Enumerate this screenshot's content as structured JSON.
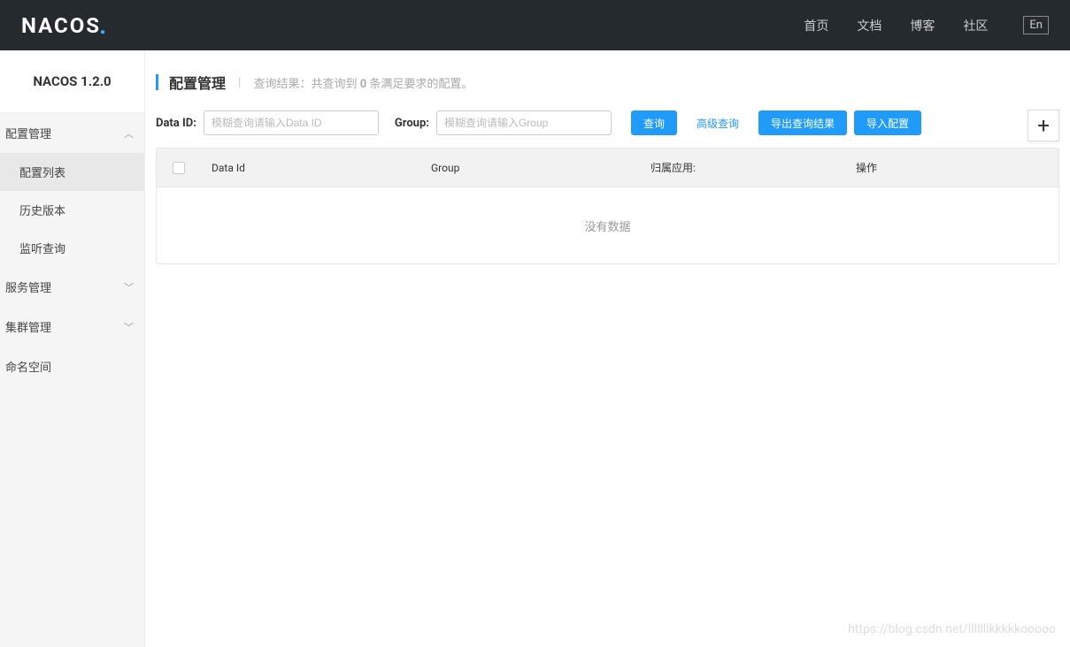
{
  "header": {
    "logo_text": "NACOS",
    "nav": [
      "首页",
      "文档",
      "博客",
      "社区"
    ],
    "lang": "En"
  },
  "sidebar": {
    "version": "NACOS 1.2.0",
    "groups": [
      {
        "label": "配置管理",
        "expanded": true,
        "items": [
          "配置列表",
          "历史版本",
          "监听查询"
        ],
        "active_item": 0
      },
      {
        "label": "服务管理",
        "expanded": false
      },
      {
        "label": "集群管理",
        "expanded": false
      },
      {
        "label": "命名空间",
        "expanded": null
      }
    ]
  },
  "main": {
    "title": "配置管理",
    "summary_prefix": "查询结果：共查询到",
    "summary_count": "0",
    "summary_suffix": "条满足要求的配置。",
    "filters": {
      "dataid_label": "Data ID:",
      "dataid_placeholder": "模糊查询请输入Data ID",
      "group_label": "Group:",
      "group_placeholder": "模糊查询请输入Group"
    },
    "buttons": {
      "query": "查询",
      "advanced": "高级查询",
      "export": "导出查询结果",
      "import": "导入配置"
    },
    "table": {
      "columns": [
        "Data Id",
        "Group",
        "归属应用:",
        "操作"
      ],
      "empty_text": "没有数据"
    }
  },
  "watermark": "https://blog.csdn.net/lllllllkkkkkooooo"
}
